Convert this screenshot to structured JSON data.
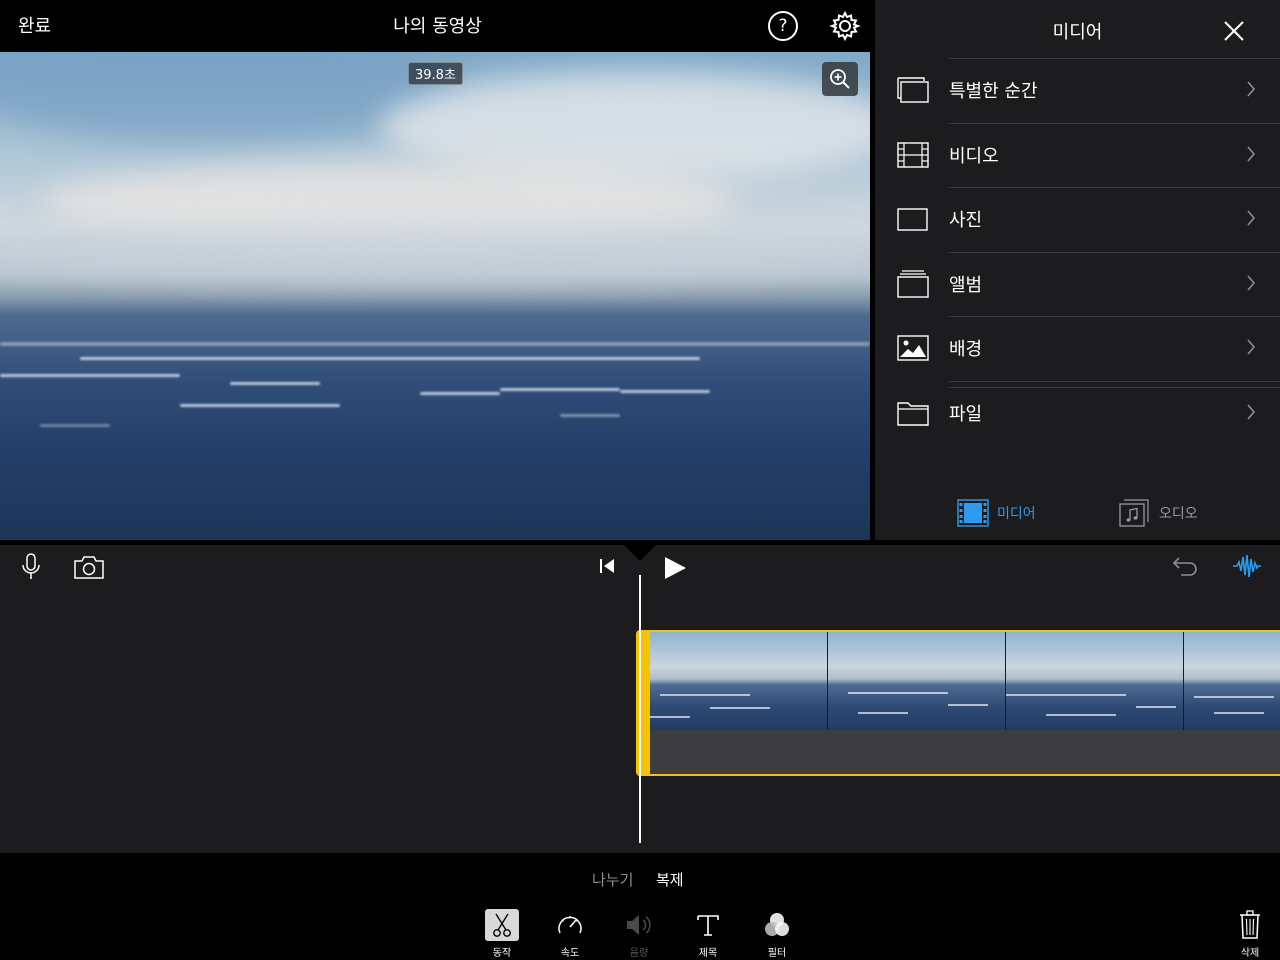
{
  "header": {
    "done_label": "완료",
    "project_title": "나의 동영상",
    "help_glyph": "?"
  },
  "viewer": {
    "duration_badge": "39.8초"
  },
  "media_panel": {
    "title": "미디어",
    "items": [
      {
        "label": "특별한 순간",
        "icon": "moments-icon"
      },
      {
        "label": "비디오",
        "icon": "film-icon"
      },
      {
        "label": "사진",
        "icon": "photo-frame-icon"
      },
      {
        "label": "앨범",
        "icon": "album-stack-icon"
      },
      {
        "label": "배경",
        "icon": "landscape-icon"
      },
      {
        "label": "파일",
        "icon": "folder-icon"
      }
    ],
    "segments": {
      "media_label": "미디어",
      "audio_label": "오디오",
      "selected": "미디어"
    }
  },
  "bottom_toolbar": {
    "split_label": "나누기",
    "duplicate_label": "복제",
    "tools": [
      {
        "label": "동작",
        "icon": "scissors-icon",
        "state": "selected"
      },
      {
        "label": "속도",
        "icon": "speedometer-icon",
        "state": "normal"
      },
      {
        "label": "음량",
        "icon": "speaker-icon",
        "state": "disabled"
      },
      {
        "label": "제목",
        "icon": "title-t-icon",
        "state": "normal"
      },
      {
        "label": "필터",
        "icon": "filter-circles-icon",
        "state": "normal"
      }
    ],
    "delete_label": "삭제"
  },
  "colors": {
    "accent_blue": "#2d9cf0",
    "clip_selection_yellow": "#f5c400",
    "panel_bg": "#1c1c1e"
  }
}
